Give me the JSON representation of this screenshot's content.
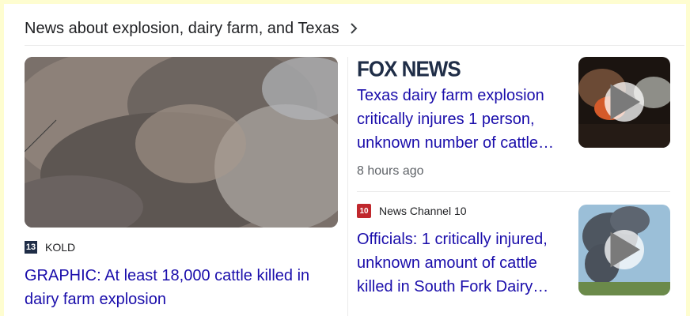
{
  "header": {
    "title": "News about explosion, dairy farm, and Texas",
    "chevron_icon": "chevron-right-icon"
  },
  "lead_story": {
    "source": "KOLD",
    "source_logo_text": "13",
    "headline": "GRAPHIC: At least 18,000 cattle killed in dairy farm explosion",
    "image": "smoke-cloud-image"
  },
  "stories": [
    {
      "source_logo_text": "FOX NEWS",
      "headline": "Texas dairy farm explosion critically injures 1 person, unknown number of cattle…",
      "time": "8 hours ago",
      "has_video": true
    },
    {
      "source": "News Channel 10",
      "source_logo_text": "10",
      "headline": "Officials: 1 critically injured, unknown amount of cattle killed in South Fork Dairy…",
      "has_video": true
    }
  ],
  "colors": {
    "link": "#1a0dab",
    "background": "#fefdd0"
  }
}
